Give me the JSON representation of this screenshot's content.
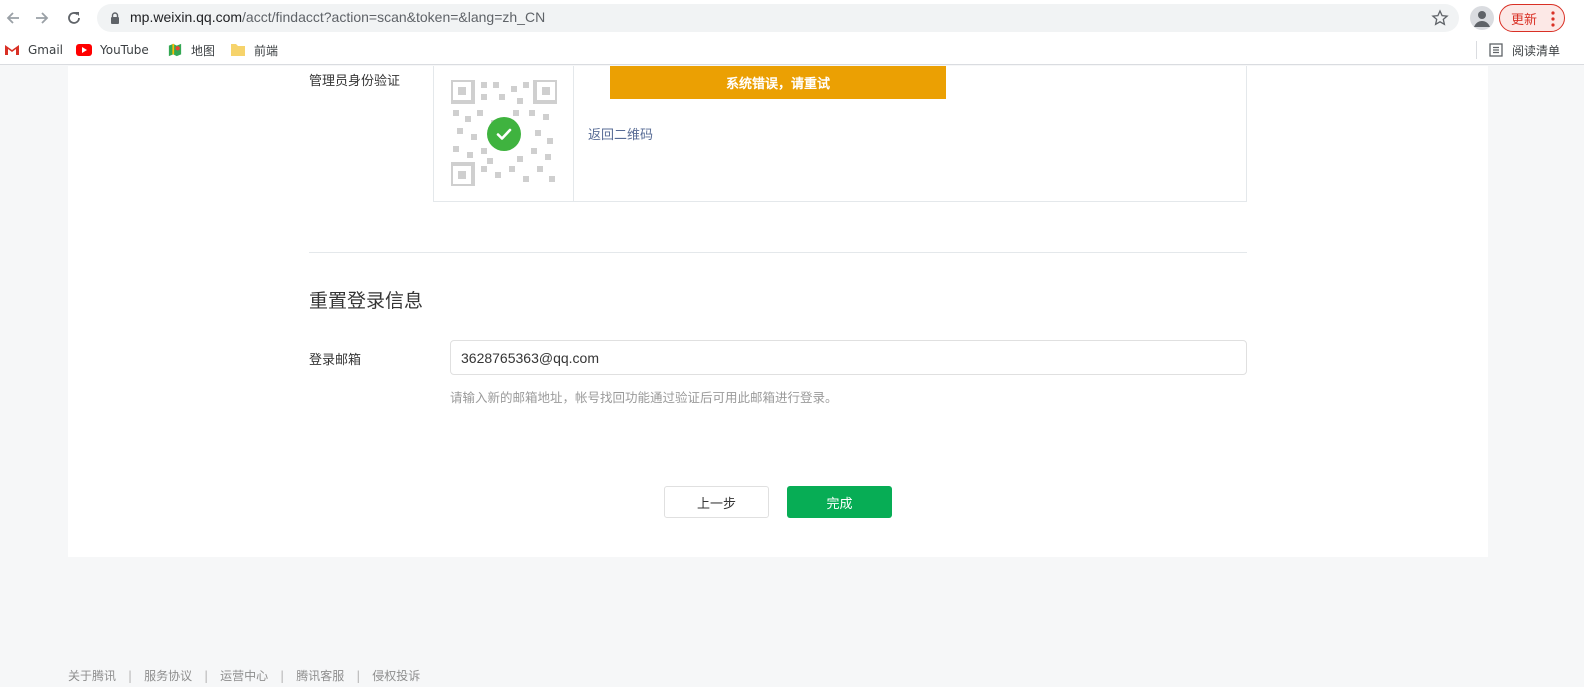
{
  "browser": {
    "url_host": "mp.weixin.qq.com",
    "url_path": "/acct/findacct?action=scan&token=&lang=zh_CN",
    "update_label": "更新",
    "bookmarks": [
      {
        "label": "Gmail",
        "icon": "gmail-icon"
      },
      {
        "label": "YouTube",
        "icon": "youtube-icon"
      },
      {
        "label": "地图",
        "icon": "maps-icon"
      },
      {
        "label": "前端",
        "icon": "folder-icon"
      }
    ],
    "reading_list_label": "阅读清单"
  },
  "verify": {
    "label": "管理员身份验证",
    "error_message": "系统错误，请重试",
    "back_link": "返回二维码"
  },
  "reset": {
    "section_title": "重置登录信息",
    "email_label": "登录邮箱",
    "email_value": "3628765363@qq.com",
    "hint": "请输入新的邮箱地址，帐号找回功能通过验证后可用此邮箱进行登录。"
  },
  "actions": {
    "prev_label": "上一步",
    "done_label": "完成"
  },
  "footer": {
    "links": [
      "关于腾讯",
      "服务协议",
      "运营中心",
      "腾讯客服",
      "侵权投诉"
    ]
  },
  "colors": {
    "error_bar": "#eba003",
    "primary_button": "#07ad55",
    "link": "#576b95",
    "check": "#3fb33f"
  }
}
